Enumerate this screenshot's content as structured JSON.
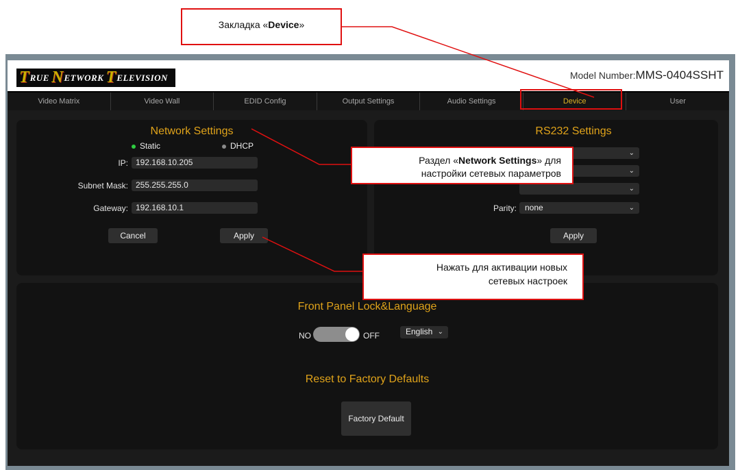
{
  "header": {
    "model_label": "Model Number:",
    "model_value": "MMS-0404SSHT"
  },
  "logo": {
    "name": "True Network Television",
    "parts": [
      {
        "big": "T",
        "rest": "RUE"
      },
      {
        "big": "N",
        "rest": "ETWORK"
      },
      {
        "big": "T",
        "rest": "ELEVISION"
      }
    ]
  },
  "tabs": [
    {
      "label": "Video Matrix",
      "active": false
    },
    {
      "label": "Video Wall",
      "active": false
    },
    {
      "label": "EDID Config",
      "active": false
    },
    {
      "label": "Output Settings",
      "active": false
    },
    {
      "label": "Audio Settings",
      "active": false
    },
    {
      "label": "Device",
      "active": true
    },
    {
      "label": "User",
      "active": false
    }
  ],
  "network": {
    "title": "Network Settings",
    "static_label": "Static",
    "dhcp_label": "DHCP",
    "ip_label": "IP:",
    "ip_value": "192.168.10.205",
    "mask_label": "Subnet Mask:",
    "mask_value": "255.255.255.0",
    "gateway_label": "Gateway:",
    "gateway_value": "192.168.10.1",
    "cancel_label": "Cancel",
    "apply_label": "Apply"
  },
  "rs232": {
    "title": "RS232 Settings",
    "parity_label": "Parity:",
    "parity_value": "none",
    "apply_label": "Apply"
  },
  "front_panel": {
    "title": "Front Panel Lock&Language",
    "no_label": "NO",
    "off_label": "OFF",
    "language": "English"
  },
  "reset": {
    "title": "Reset to Factory Defaults",
    "button_label": "Factory Default"
  },
  "callouts": {
    "device_pre": "Закладка «",
    "device_bold": "Device",
    "device_post": "»",
    "network_pre": "Раздел «",
    "network_bold": "Network Settings",
    "network_post": "» для",
    "network_line2": "настройки сетевых параметров",
    "apply_line1": "Нажать для активации новых",
    "apply_line2": "сетевых настроек"
  },
  "colors": {
    "accent": "#e0a31a",
    "callout_border": "#e01010",
    "static_dot": "#2ecc40",
    "dhcp_dot": "#8a8a8a"
  }
}
